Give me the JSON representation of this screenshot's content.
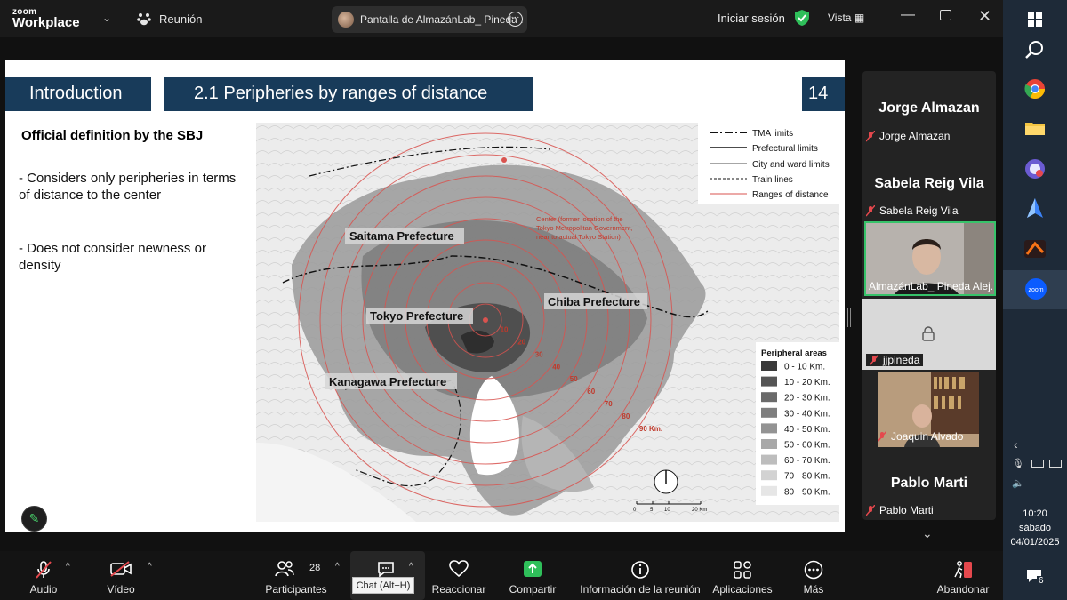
{
  "app": {
    "logo_line1": "zoom",
    "logo_line2": "Workplace",
    "meeting_label": "Reunión",
    "share_title": "Pantalla de AlmazánLab_ Pineda .",
    "signin": "Iniciar sesión",
    "view_label": "Vista"
  },
  "slide": {
    "intro": "Introduction",
    "section": "2.1 Peripheries by ranges of distance",
    "page": "14",
    "def_title": "Official definition by the SBJ",
    "bullet1": "- Considers only peripheries in terms of distance to the  center",
    "bullet2": "- Does not consider newness or density"
  },
  "map": {
    "legend_lines": [
      "TMA limits",
      "Prefectural limits",
      "City and ward limits",
      "Train lines",
      "Ranges of distance"
    ],
    "center_note": [
      "Center (former location of the",
      "Tokyo Metropolitan Government,",
      "near to actual Tokyo Station)"
    ],
    "prefectures": [
      "Saitama Prefecture",
      "Tokyo Prefecture",
      "Chiba Prefecture",
      "Kanagawa Prefecture"
    ],
    "ring_labels": [
      "10",
      "20",
      "30",
      "40",
      "50",
      "60",
      "70",
      "80",
      "90 Km."
    ],
    "peripheral_title": "Peripheral areas",
    "peripheral_ranges": [
      {
        "label": "0 - 10 Km.",
        "color": "#3a3a3a"
      },
      {
        "label": "10 - 20 Km.",
        "color": "#555555"
      },
      {
        "label": "20 - 30 Km.",
        "color": "#6a6a6a"
      },
      {
        "label": "30 - 40 Km.",
        "color": "#7e7e7e"
      },
      {
        "label": "40 - 50 Km.",
        "color": "#939393"
      },
      {
        "label": "50 - 60 Km.",
        "color": "#a8a8a8"
      },
      {
        "label": "60 - 70 Km.",
        "color": "#bdbdbd"
      },
      {
        "label": "70 - 80 Km.",
        "color": "#d2d2d2"
      },
      {
        "label": "80 - 90 Km.",
        "color": "#e6e6e6"
      }
    ],
    "scale_labels": [
      "0",
      "5",
      "10",
      "20 Km"
    ]
  },
  "gallery": {
    "participants": [
      {
        "display": "Jorge Almazan",
        "label": "Jorge Almazan"
      },
      {
        "display": "Sabela Reig Vila",
        "label": "Sabela Reig Vila"
      },
      {
        "display": "",
        "label": "AlmazánLab_ Pineda Alej..."
      },
      {
        "display": "",
        "label": "jjpineda"
      },
      {
        "display": "",
        "label": "Joaquin Alvado"
      },
      {
        "display": "Pablo Marti",
        "label": "Pablo Marti"
      }
    ]
  },
  "toolbar": {
    "audio": "Audio",
    "video": "Vídeo",
    "participants": "Participantes",
    "participants_count": "28",
    "chat_tooltip": "Chat (Alt+H)",
    "react": "Reaccionar",
    "share": "Compartir",
    "info": "Información de la reunión",
    "apps": "Aplicaciones",
    "more": "Más",
    "leave": "Abandonar"
  },
  "taskbar": {
    "time": "10:20",
    "day": "sábado",
    "date": "04/01/2025",
    "notifications": "6"
  },
  "colors": {
    "accent_green": "#37c36a",
    "slide_navy": "#183b5a",
    "ring_red": "#d9534f",
    "leave_red": "#e5484d"
  }
}
